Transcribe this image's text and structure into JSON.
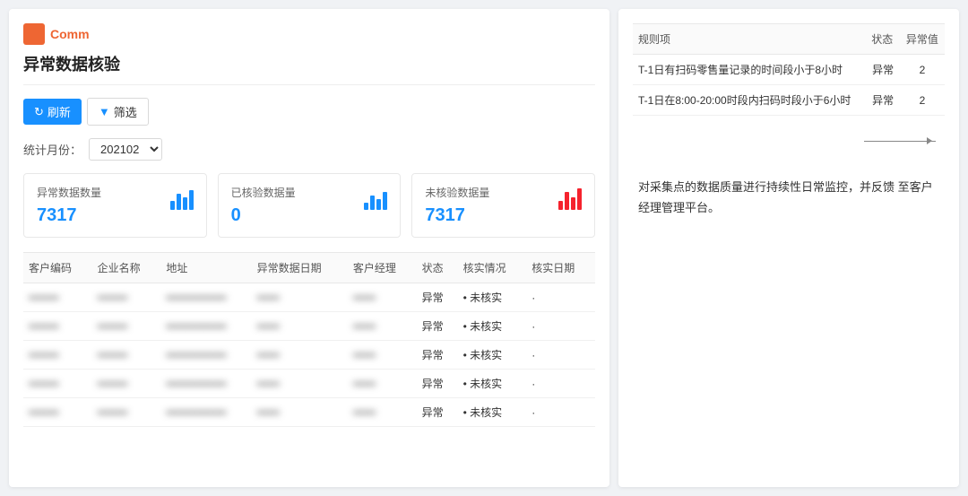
{
  "app": {
    "logo_text": "Comm"
  },
  "page": {
    "title": "异常数据核验"
  },
  "toolbar": {
    "refresh_label": "刷新",
    "filter_label": "筛选"
  },
  "filter": {
    "label": "统计月份：",
    "value": "202102"
  },
  "stats": [
    {
      "label": "异常数据数量",
      "value": "7317",
      "bar_type": "blue"
    },
    {
      "label": "已核验数据量",
      "value": "0",
      "bar_type": "blue"
    },
    {
      "label": "未核验数据量",
      "value": "7317",
      "bar_type": "red"
    }
  ],
  "table": {
    "headers": [
      "客户编码",
      "企业名称",
      "地址",
      "异常数据日期",
      "客户经理",
      "状态",
      "核实情况",
      "核实日期"
    ],
    "rows": [
      [
        "••••••••",
        "••••••••",
        "••••••••••••••••",
        "••••••",
        "••••••",
        "异常",
        "• 未核实",
        "·"
      ],
      [
        "••••••••",
        "••••••••",
        "••••••••••••••••",
        "••••••",
        "••••••",
        "异常",
        "• 未核实",
        "·"
      ],
      [
        "••••••••",
        "••••••••",
        "••••••••••••••••",
        "••••••",
        "••••••",
        "异常",
        "• 未核实",
        "·"
      ],
      [
        "••••••••",
        "••••••••",
        "••••••••••••••••",
        "••••••",
        "••••••",
        "异常",
        "• 未核实",
        "·"
      ],
      [
        "••••••••",
        "••••••••",
        "••••••••••••••••",
        "••••••",
        "••••••",
        "异常",
        "• 未核实",
        "·"
      ]
    ]
  },
  "right_panel": {
    "rule_table": {
      "headers": [
        "规则项",
        "状态",
        "异常值"
      ],
      "rows": [
        {
          "rule": "T-1日有扫码零售量记录的时间段小于8小时",
          "status": "异常",
          "value": "2"
        },
        {
          "rule": "T-1日在8:00-20:00时段内扫码时段小于6小时",
          "status": "异常",
          "value": "2"
        }
      ]
    },
    "description": "对采集点的数据质量进行持续性日常监控，并反馈\n至客户经理管理平台。"
  }
}
